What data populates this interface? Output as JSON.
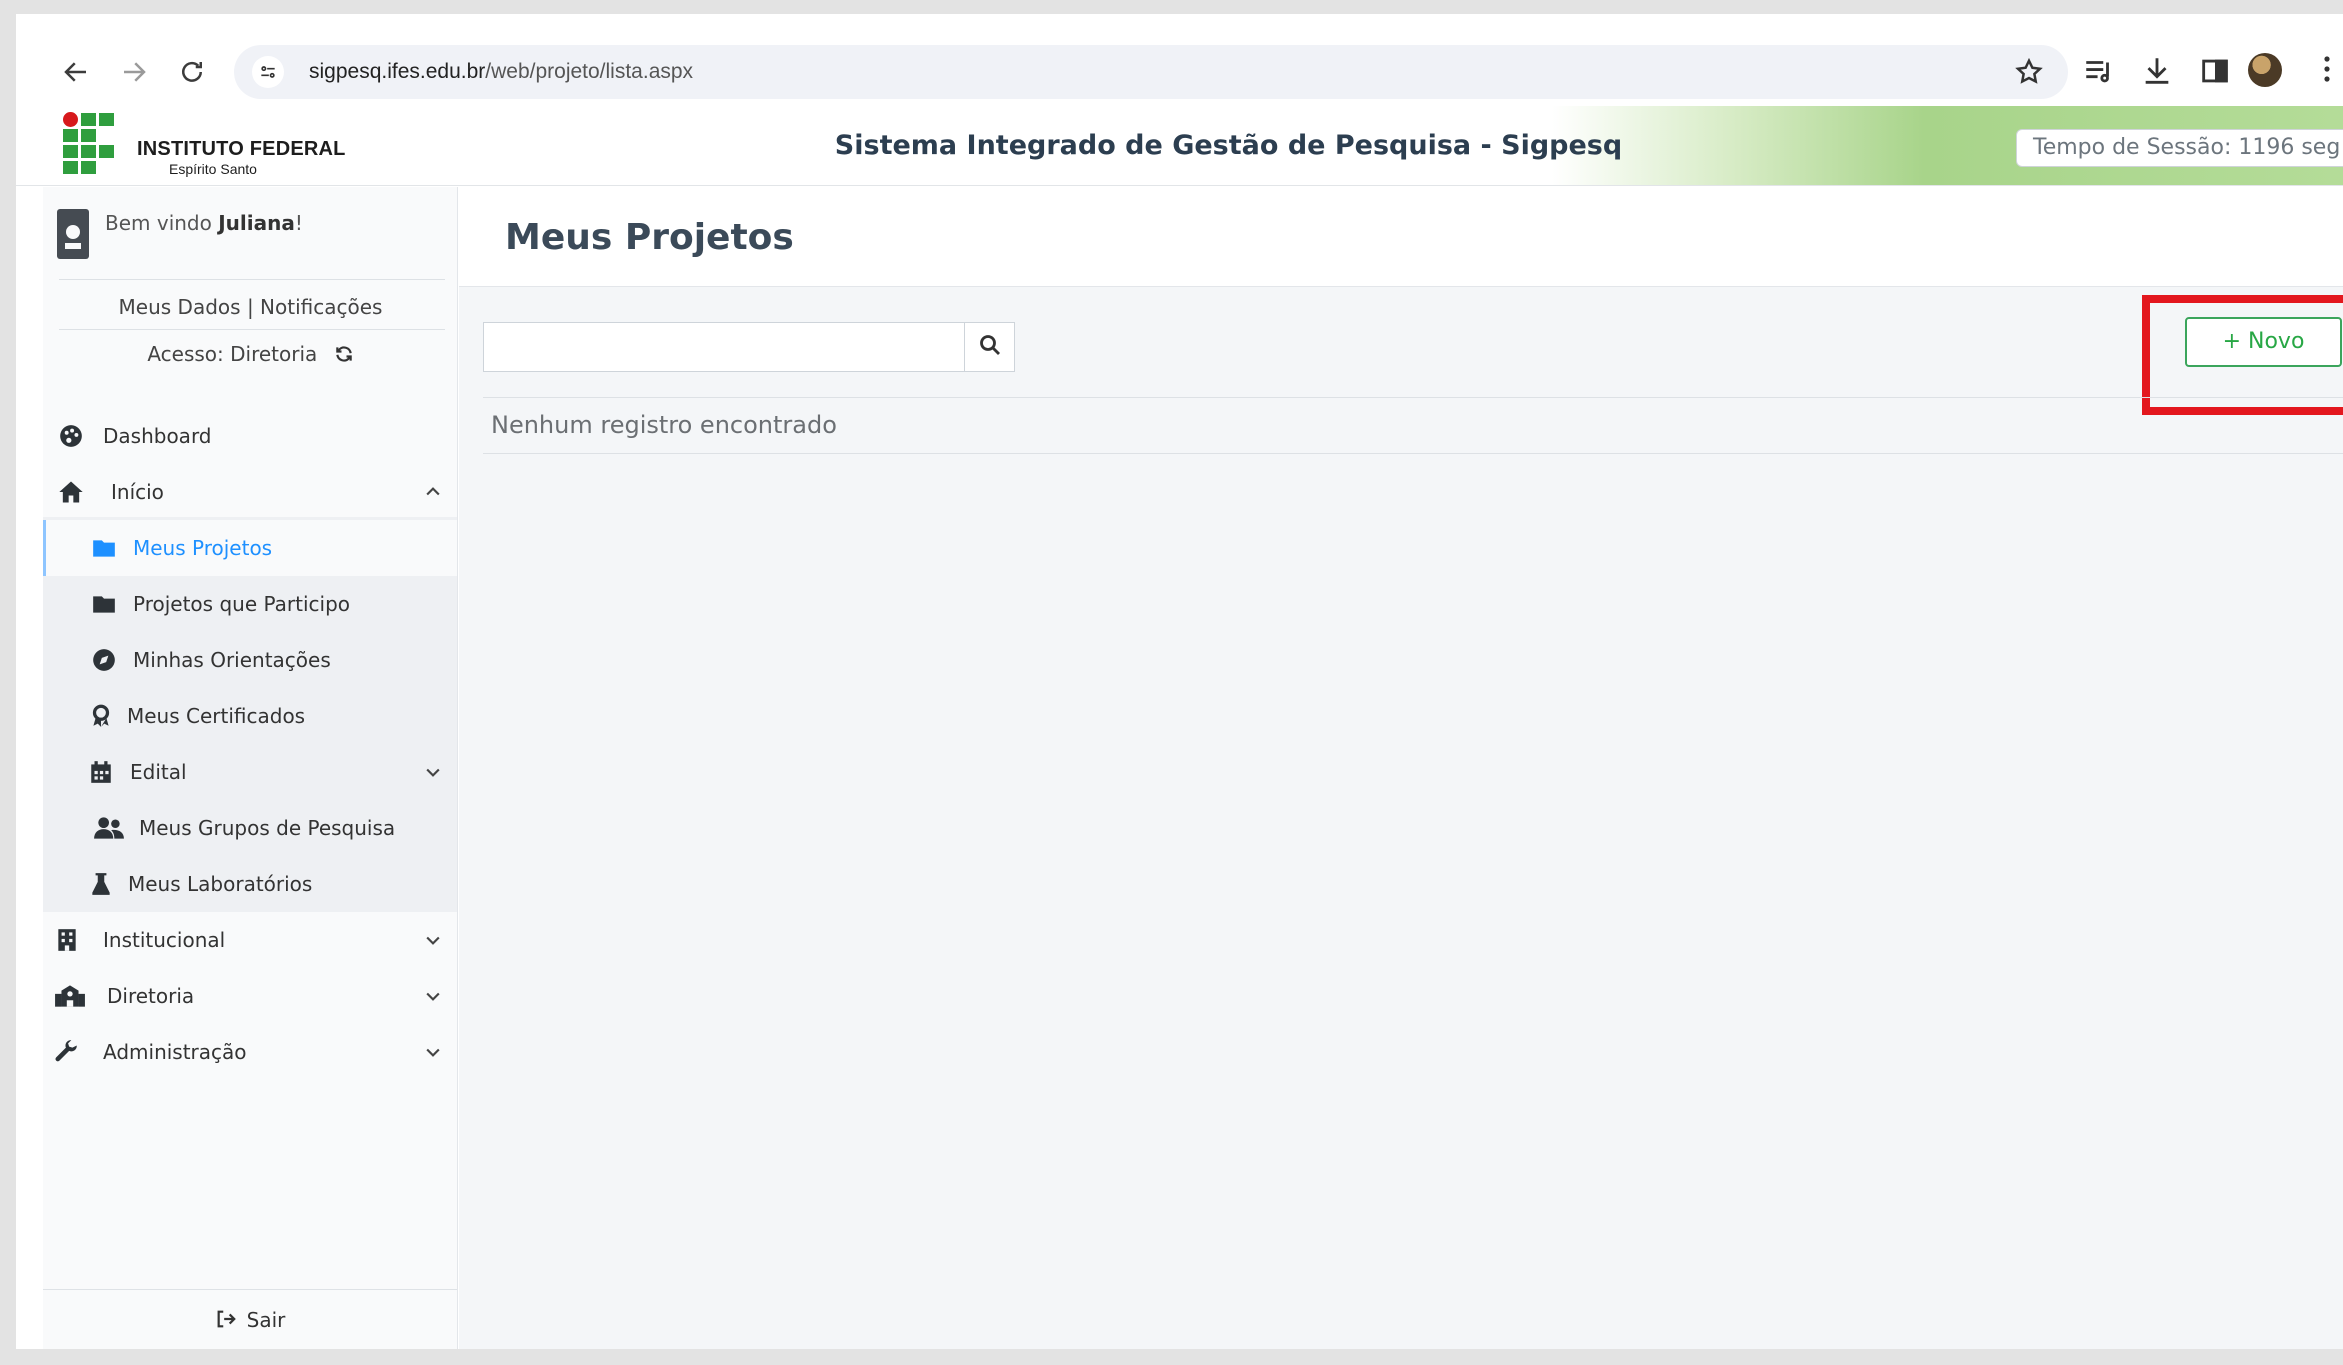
{
  "browser": {
    "url_host": "sigpesq.ifes.edu.br",
    "url_path": "/web/projeto/lista.aspx"
  },
  "header": {
    "logo_title": "INSTITUTO FEDERAL",
    "logo_subtitle": "Espírito Santo",
    "system_title": "Sistema Integrado de Gestão de Pesquisa - Sigpesq",
    "session_label": "Tempo de Sessão: 1196 seg"
  },
  "sidebar": {
    "welcome_prefix": "Bem vindo ",
    "user_name": "Juliana",
    "welcome_suffix": "!",
    "my_data": "Meus Dados",
    "divider": "|",
    "notifications": "Notificações",
    "access": "Acesso: Diretoria",
    "items": [
      {
        "label": "Dashboard",
        "icon": "palette-icon"
      },
      {
        "label": "Início",
        "icon": "home-icon"
      },
      {
        "label": "Meus Projetos",
        "icon": "folder-icon"
      },
      {
        "label": "Projetos que Participo",
        "icon": "folder-icon"
      },
      {
        "label": "Minhas Orientações",
        "icon": "compass-icon"
      },
      {
        "label": "Meus Certificados",
        "icon": "award-icon"
      },
      {
        "label": "Edital",
        "icon": "calendar-icon"
      },
      {
        "label": "Meus Grupos de Pesquisa",
        "icon": "users-icon"
      },
      {
        "label": "Meus Laboratórios",
        "icon": "flask-icon"
      },
      {
        "label": "Institucional",
        "icon": "building-icon"
      },
      {
        "label": "Diretoria",
        "icon": "school-icon"
      },
      {
        "label": "Administração",
        "icon": "wrench-icon"
      }
    ],
    "logout": "Sair"
  },
  "main": {
    "page_title": "Meus Projetos",
    "search_value": "",
    "new_button": "+ Novo",
    "empty_message": "Nenhum registro encontrado"
  },
  "colors": {
    "accent_blue": "#1e90ff",
    "success_green": "#28a745",
    "highlight_red": "#e3171e"
  }
}
